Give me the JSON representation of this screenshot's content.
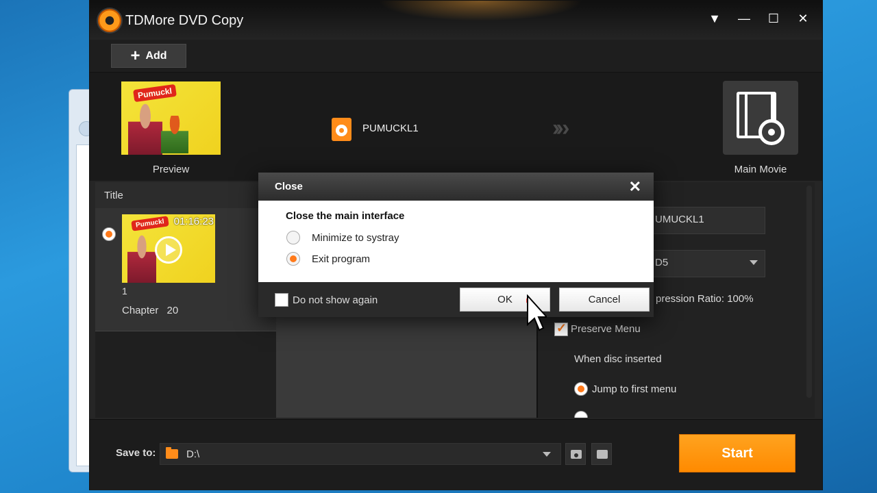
{
  "window": {
    "title": "TDMore DVD Copy",
    "controls": [
      "▼",
      "—",
      "☐",
      "✕"
    ]
  },
  "toolbar": {
    "add_label": "Add"
  },
  "source": {
    "preview_label": "Preview",
    "disc_name": "PUMUCKL1",
    "target_label": "Main Movie"
  },
  "titles": {
    "header": "Title",
    "items": [
      {
        "duration": "01:16:23",
        "number": "1",
        "chapter_label": "Chapter",
        "chapter_count": "20",
        "selected": true
      }
    ]
  },
  "settings": {
    "name_value": "UMUCKL1",
    "format_value": "D5",
    "compression_text": "pression Ratio: 100%",
    "preserve_menu_label": "Preserve Menu",
    "preserve_menu_checked": true,
    "disc_inserted_label": "When disc inserted",
    "jump_first_menu_label": "Jump to first menu"
  },
  "bottom": {
    "save_label": "Save to:",
    "path_value": "D:\\",
    "start_label": "Start"
  },
  "dialog": {
    "title": "Close",
    "question": "Close the main interface",
    "options": [
      {
        "label": "Minimize to systray",
        "selected": false
      },
      {
        "label": "Exit program",
        "selected": true
      }
    ],
    "dont_show_label": "Do not show again",
    "ok_label": "OK",
    "cancel_label": "Cancel"
  },
  "colors": {
    "accent": "#ff8a00",
    "background": "#262626"
  }
}
